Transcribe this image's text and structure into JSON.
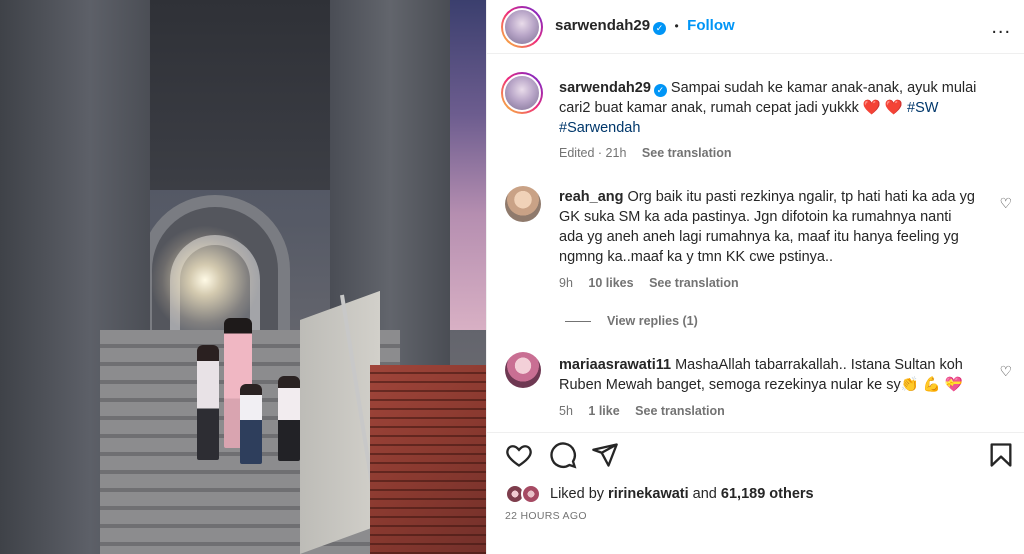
{
  "post": {
    "username": "sarwendah29",
    "follow_label": "Follow",
    "separator": "•",
    "more_label": "...",
    "caption": {
      "text": "Sampai sudah ke kamar anak-anak, ayuk mulai cari2 buat kamar anak, rumah cepat jadi yukkk ❤️ ❤️",
      "hashtag1": "#SW",
      "hashtag2": "#Sarwendah",
      "edited": "Edited · 21h",
      "see_translation": "See translation"
    }
  },
  "comments": [
    {
      "username": "reah_ang",
      "text": "Org baik itu pasti rezkinya ngalir, tp hati hati ka ada yg GK suka SM ka ada pastinya. Jgn difotoin ka rumahnya nanti ada yg aneh aneh lagi rumahnya ka, maaf itu hanya feeling yg ngmng ka..maaf ka y tmn KK cwe pstinya..",
      "time": "9h",
      "likes": "10 likes",
      "see_translation": "See translation",
      "view_replies": "View replies (1)"
    },
    {
      "username": "mariaasrawati11",
      "text": "MashaAllah tabarrakallah.. Istana Sultan koh Ruben Mewah banget, semoga rezekinya nular ke sy👏 💪 💝",
      "time": "5h",
      "likes": "1 like",
      "see_translation": "See translation"
    }
  ],
  "likes": {
    "prefix": "Liked by",
    "user": "ririnekawati",
    "and": "and",
    "count": "61,189 others"
  },
  "posted_ago": "22 HOURS AGO",
  "colors": {
    "accent": "#0095f6",
    "heart": "#ed4956",
    "muted": "#737373",
    "text": "#262626"
  },
  "icons": [
    "heart-icon",
    "comment-icon",
    "share-icon",
    "bookmark-icon",
    "more-icon",
    "verified-icon"
  ]
}
